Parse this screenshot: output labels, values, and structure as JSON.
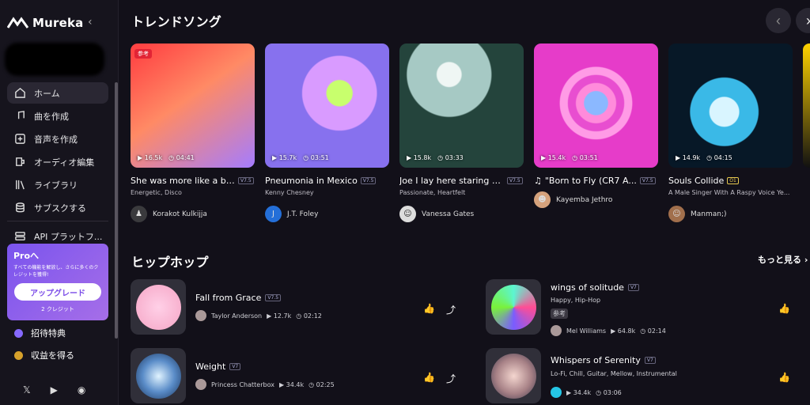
{
  "app": {
    "name": "Mureka"
  },
  "sidebar": {
    "items": [
      {
        "label": "ホーム",
        "icon": "home-icon"
      },
      {
        "label": "曲を作成",
        "icon": "music-note-icon"
      },
      {
        "label": "音声を作成",
        "icon": "voice-icon"
      },
      {
        "label": "オーディオ編集",
        "icon": "audio-edit-icon"
      },
      {
        "label": "ライブラリ",
        "icon": "library-icon"
      },
      {
        "label": "サブスクする",
        "icon": "database-icon"
      },
      {
        "label": "API プラットフ...",
        "icon": "api-icon"
      }
    ],
    "pro": {
      "title": "Proへ",
      "description": "すべての機能を解放し、さらに多くのクレジットを獲得!",
      "button": "アップグレード",
      "credits": "2 クレジット"
    },
    "invite": "招待特典",
    "earn": "収益を得る"
  },
  "trending": {
    "title": "トレンドソング",
    "cards": [
      {
        "title": "She was more like a be...",
        "version": "V7.5",
        "description": "Energetic, Disco",
        "plays": "16.5k",
        "duration": "04:41",
        "artist": "Korakot Kulkijja",
        "tag": "参考",
        "colors": [
          "#fa4949",
          "#fd8766",
          "#9b7ef3"
        ]
      },
      {
        "title": "Pneumonia in Mexico",
        "version": "V7.5",
        "description": "Kenny Chesney",
        "plays": "15.7k",
        "duration": "03:51",
        "artist": "J.T. Foley",
        "colors": [
          "#8e82f1",
          "#d1a8ff",
          "#78e26f"
        ]
      },
      {
        "title": "Joe I lay here staring a...",
        "version": "V7.5",
        "description": "Passionate, Heartfelt",
        "plays": "15.8k",
        "duration": "03:33",
        "artist": "Vanessa Gates",
        "colors": [
          "#1f3a35",
          "#8cb9b0",
          "#e6efee"
        ]
      },
      {
        "title": "\"Born to Fly (CR7 A...",
        "version": "V7.5",
        "description": "",
        "plays": "15.4k",
        "duration": "03:51",
        "artist": "Kayemba Jethro",
        "colors": [
          "#e63cc9",
          "#ff82d9",
          "#82b8ff"
        ]
      },
      {
        "title": "Souls Collide",
        "version": "O1",
        "description": "A Male Singer With A Raspy Voice Ye...",
        "plays": "14.9k",
        "duration": "04:15",
        "artist": "Manman;)",
        "colors": [
          "#021a28",
          "#35b7e8",
          "#d5f2fb"
        ]
      }
    ]
  },
  "hiphop": {
    "title": "ヒップホップ",
    "more": "もっと見る",
    "songs": [
      {
        "title": "Fall from Grace",
        "version": "V7.5",
        "artist": "Taylor Anderson",
        "plays": "12.7k",
        "duration": "02:12"
      },
      {
        "title": "wings of solitude",
        "version": "V7",
        "subtitle": "Happy, Hip-Hop",
        "tag": "参考",
        "artist": "Mel Williams",
        "plays": "64.8k",
        "duration": "02:14"
      },
      {
        "title": "Weight",
        "version": "V7",
        "artist": "Princess Chatterbox",
        "plays": "34.4k",
        "duration": "02:25"
      },
      {
        "title": "Whispers of Serenity",
        "version": "V7",
        "subtitle": "Lo-Fi, Chill, Guitar, Mellow, Instrumental",
        "plays": "34.4k",
        "duration": "03:06"
      }
    ]
  }
}
